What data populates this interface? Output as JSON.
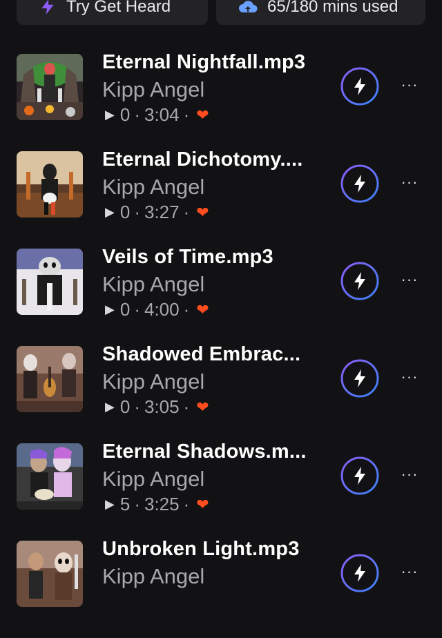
{
  "header": {
    "get_heard_label": "Try Get Heard",
    "usage_label": "65/180 mins used"
  },
  "tracks": [
    {
      "title": "Eternal Nightfall.mp3",
      "artist": "Kipp Angel",
      "plays": "0",
      "duration": "3:04"
    },
    {
      "title": "Eternal Dichotomy....",
      "artist": "Kipp Angel",
      "plays": "0",
      "duration": "3:27"
    },
    {
      "title": "Veils of Time.mp3",
      "artist": "Kipp Angel",
      "plays": "0",
      "duration": "4:00"
    },
    {
      "title": "Shadowed Embrac...",
      "artist": "Kipp Angel",
      "plays": "0",
      "duration": "3:05"
    },
    {
      "title": "Eternal Shadows.m...",
      "artist": "Kipp Angel",
      "plays": "5",
      "duration": "3:25"
    },
    {
      "title": "Unbroken Light.mp3",
      "artist": "Kipp Angel",
      "plays": "",
      "duration": ""
    }
  ],
  "icons": {
    "get_heard": "lightning-icon",
    "usage": "cloud-upload-icon",
    "play": "play-icon",
    "liked": "heart-icon",
    "boost": "lightning-icon",
    "more": "more-icon"
  },
  "colors": {
    "background": "#121214",
    "pill": "#232326",
    "accent_purple": "#8b5cf6",
    "accent_blue": "#3b82f6",
    "heart": "#ff4d1f"
  }
}
